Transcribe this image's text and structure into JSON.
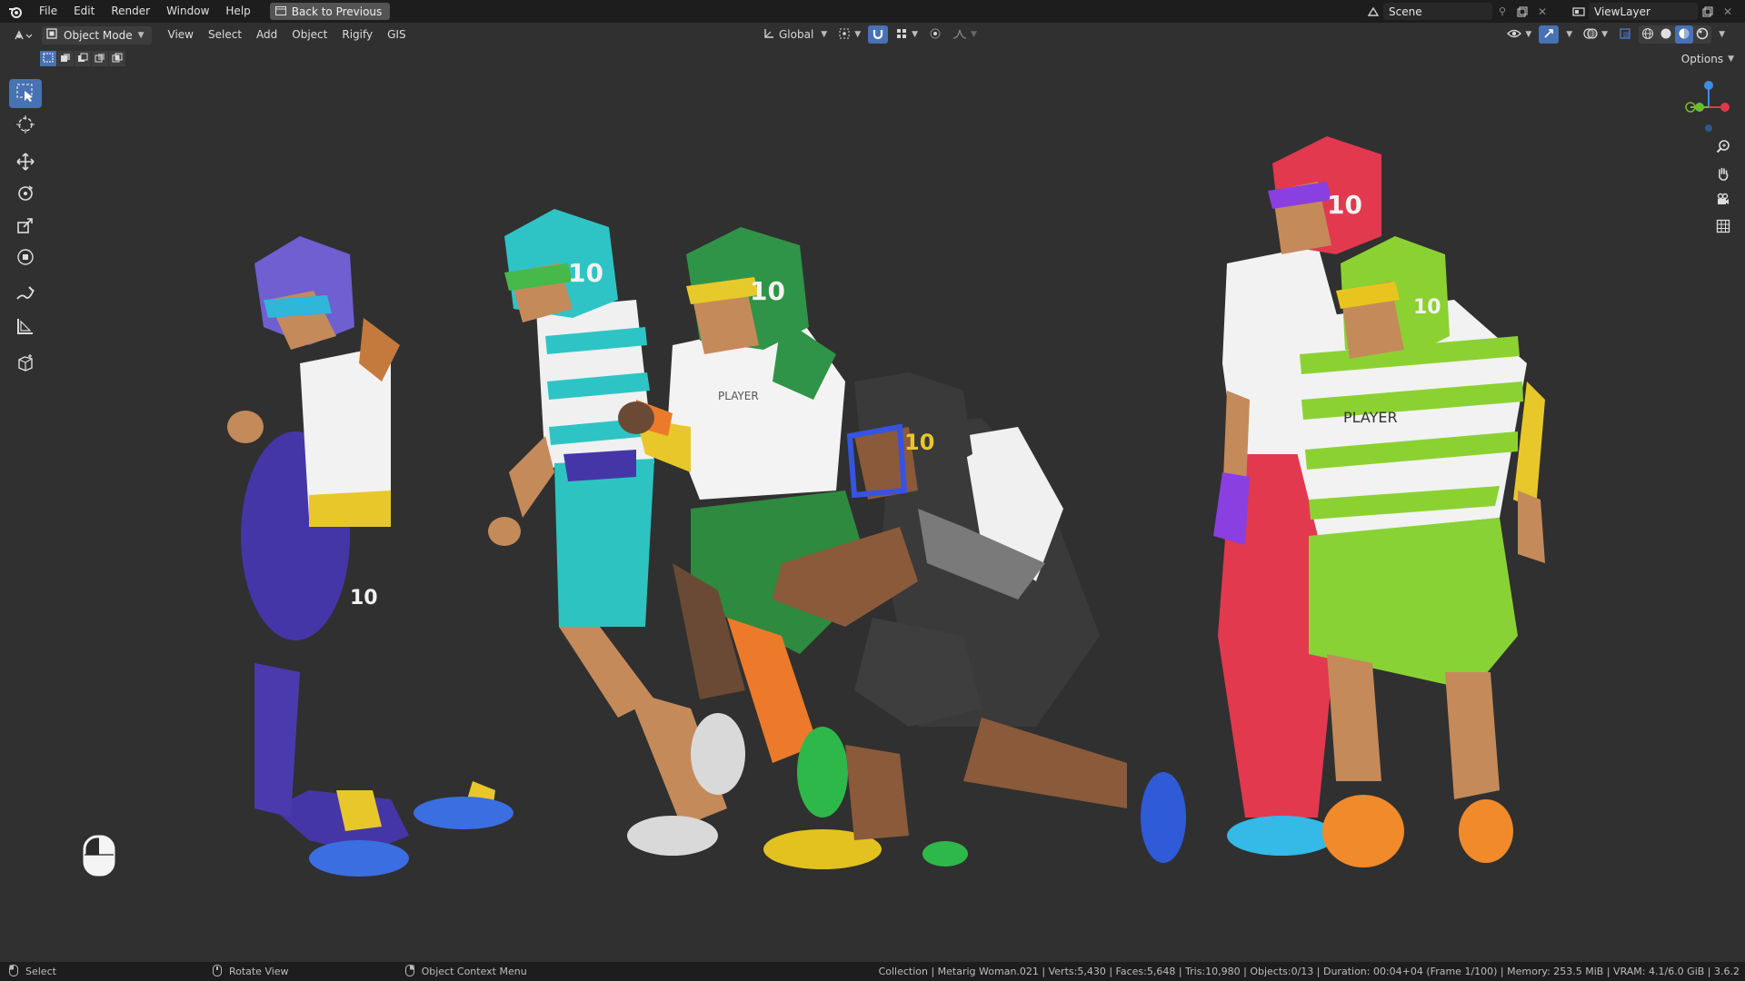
{
  "topbar": {
    "menus": [
      "File",
      "Edit",
      "Render",
      "Window",
      "Help"
    ],
    "back_button": "Back to Previous",
    "scene_name": "Scene",
    "view_layer": "ViewLayer"
  },
  "viewport_header": {
    "mode": "Object Mode",
    "menus": [
      "View",
      "Select",
      "Add",
      "Object",
      "Rigify",
      "GIS"
    ],
    "transform_orientation": "Global",
    "options_label": "Options"
  },
  "toolbar": {
    "tools": [
      "select-box",
      "cursor",
      "move",
      "rotate",
      "scale",
      "transform",
      "annotate",
      "measure",
      "add-cube"
    ],
    "active_tool": "select-box"
  },
  "gizmo": {
    "axes": [
      "Z",
      "X",
      "Y"
    ],
    "colors": {
      "x": "#e2374d",
      "y": "#6ebc34",
      "z": "#3a8fe0"
    }
  },
  "scene": {
    "jersey_number": "10",
    "jersey_text": "PLAYER",
    "players": [
      {
        "helmet": "#6f5fd1",
        "facemask": "#2fb6d8",
        "pants": "#4536a8",
        "shoes": "#3b6ee0"
      },
      {
        "helmet": "#2ec4c6",
        "facemask": "#47b84a",
        "pants": "#2dc3c0",
        "shoes": "#d9d9d9"
      },
      {
        "helmet": "#2f9447",
        "facemask": "#e6c92a",
        "pants": "#2d8a3e",
        "shoes": "#e3c21f"
      },
      {
        "helmet": "#3a3a3a",
        "facemask": "#3554e0",
        "pants": "#3e3e3e",
        "shoes": "#2f5ad8"
      },
      {
        "helmet": "#e2394f",
        "facemask": "#8a3fe0",
        "pants": "#e2394f",
        "shoes": "#35b9e6"
      },
      {
        "helmet": "#8cd132",
        "facemask": "#e8c51e",
        "pants": "#88d236",
        "shoes": "#f08a2a"
      }
    ]
  },
  "statusbar": {
    "select_label": "Select",
    "rotate_label": "Rotate View",
    "context_label": "Object Context Menu",
    "stats": "Collection | Metarig Woman.021 | Verts:5,430 | Faces:5,648 | Tris:10,980 | Objects:0/13 | Duration: 00:04+04 (Frame 1/100) | Memory: 253.5 MiB | VRAM: 4.1/6.0 GiB | 3.6.2"
  },
  "colors": {
    "accent": "#4772b3",
    "background": "#303030",
    "bar": "#1d1d1d"
  }
}
